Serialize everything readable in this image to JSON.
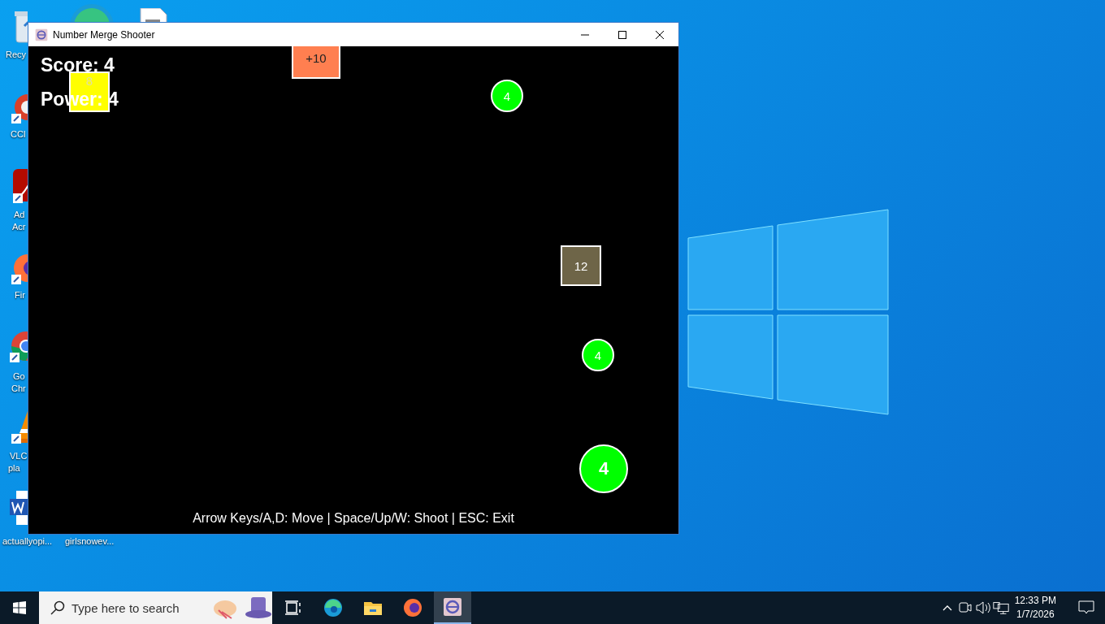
{
  "desktop": {
    "icons": [
      {
        "kind": "recycle",
        "lines": [
          "Recy"
        ]
      },
      {
        "kind": "ccleaner",
        "lines": [
          "CCl"
        ]
      },
      {
        "kind": "acrobat",
        "lines": [
          "Ad",
          "Acr"
        ]
      },
      {
        "kind": "firefox",
        "lines": [
          "Fir"
        ]
      },
      {
        "kind": "chrome",
        "lines": [
          "Go",
          "Chr"
        ]
      },
      {
        "kind": "vlc",
        "lines": [
          "VLC",
          "pla"
        ]
      },
      {
        "kind": "word",
        "lines": [
          "actuallyopi..."
        ]
      },
      {
        "kind": "edge"
      },
      {
        "kind": "file",
        "lines": [
          "girlsnowev..."
        ]
      }
    ]
  },
  "window": {
    "title": "Number Merge Shooter",
    "game": {
      "score": "Score: 4",
      "power": "Power: 4",
      "objects": [
        {
          "kind": "block",
          "text": "+10",
          "color": "#ff7f50"
        },
        {
          "kind": "block",
          "text": "8",
          "color": "#ffff00"
        },
        {
          "kind": "ball",
          "text": "4",
          "color": "#00ff00"
        },
        {
          "kind": "block",
          "text": "12",
          "color": "#6e6548"
        },
        {
          "kind": "ball",
          "text": "4",
          "color": "#00ff00"
        },
        {
          "kind": "player",
          "text": "4",
          "color": "#00ff00"
        }
      ],
      "help": "Arrow Keys/A,D: Move | Space/Up/W: Shoot | ESC: Exit"
    }
  },
  "taskbar": {
    "search": {
      "placeholder": "Type here to search"
    },
    "apps": [
      {
        "kind": "taskview",
        "selected": false
      },
      {
        "kind": "edge",
        "selected": false
      },
      {
        "kind": "explorer",
        "selected": false
      },
      {
        "kind": "firefox",
        "selected": false
      },
      {
        "kind": "game",
        "selected": true
      }
    ],
    "clock": {
      "time": "12:33 PM",
      "date": "1/7/2026"
    }
  }
}
